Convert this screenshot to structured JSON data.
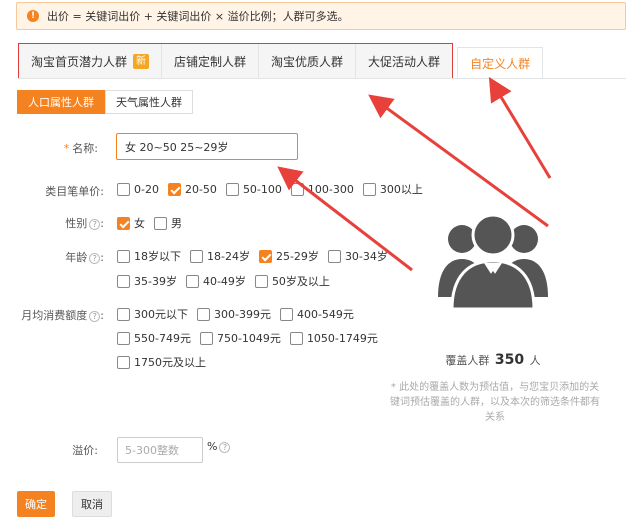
{
  "notice": {
    "text": "出价 = 关键词出价 + 关键词出价 × 溢价比例；人群可多选。"
  },
  "tabs": [
    {
      "label": "淘宝首页潜力人群",
      "badge": "新"
    },
    {
      "label": "店铺定制人群"
    },
    {
      "label": "淘宝优质人群"
    },
    {
      "label": "大促活动人群"
    },
    {
      "label": "自定义人群",
      "active": true
    }
  ],
  "subtabs": [
    {
      "label": "人口属性人群",
      "active": true
    },
    {
      "label": "天气属性人群"
    }
  ],
  "form": {
    "name_label": "名称:",
    "name_required": "*",
    "name_value": "女  20~50  25~29岁",
    "price_label": "类目笔单价:",
    "price_options": [
      {
        "label": "0-20",
        "checked": false
      },
      {
        "label": "20-50",
        "checked": true
      },
      {
        "label": "50-100",
        "checked": false
      },
      {
        "label": "100-300",
        "checked": false
      },
      {
        "label": "300以上",
        "checked": false
      }
    ],
    "gender_label": "性别",
    "gender_options": [
      {
        "label": "女",
        "checked": true
      },
      {
        "label": "男",
        "checked": false
      }
    ],
    "age_label": "年龄",
    "age_options_row1": [
      {
        "label": "18岁以下",
        "checked": false
      },
      {
        "label": "18-24岁",
        "checked": false
      },
      {
        "label": "25-29岁",
        "checked": true
      },
      {
        "label": "30-34岁",
        "checked": false
      }
    ],
    "age_options_row2": [
      {
        "label": "35-39岁",
        "checked": false
      },
      {
        "label": "40-49岁",
        "checked": false
      },
      {
        "label": "50岁及以上",
        "checked": false
      }
    ],
    "spend_label": "月均消费额度",
    "spend_row1": [
      {
        "label": "300元以下",
        "checked": false
      },
      {
        "label": "300-399元",
        "checked": false
      },
      {
        "label": "400-549元",
        "checked": false
      }
    ],
    "spend_row2": [
      {
        "label": "550-749元",
        "checked": false
      },
      {
        "label": "750-1049元",
        "checked": false
      },
      {
        "label": "1050-1749元",
        "checked": false
      }
    ],
    "spend_row3": [
      {
        "label": "1750元及以上",
        "checked": false
      }
    ],
    "premium_label": "溢价:",
    "premium_placeholder": "5-300整数",
    "premium_unit": "%",
    "help_glyph": "?",
    "colon": ":"
  },
  "buttons": {
    "ok": "确定",
    "cancel": "取消"
  },
  "coverage": {
    "prefix": "覆盖人群",
    "count": "350",
    "suffix": "人"
  },
  "note": "* 此处的覆盖人数为预估值，与您宝贝添加的关键词预估覆盖的人群，以及本次的筛选条件都有关系",
  "colors": {
    "accent": "#f58220",
    "highlight": "#e03a3a",
    "notice_bg": "#fff4e5",
    "icon": "#555555"
  },
  "icons": {
    "notice": "warning-icon",
    "audience": "people-group-icon"
  }
}
